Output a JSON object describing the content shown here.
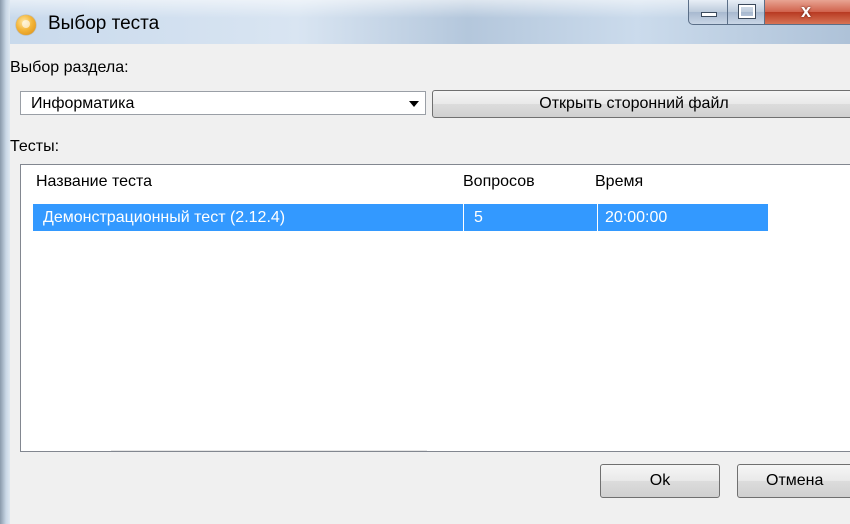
{
  "window": {
    "title": "Выбор теста"
  },
  "section": {
    "label": "Выбор раздела:",
    "selected": "Информатика"
  },
  "toolbar": {
    "open_file_label": "Открыть сторонний файл"
  },
  "tests": {
    "label": "Тесты:",
    "columns": [
      "Название теста",
      "Вопросов",
      "Время"
    ],
    "rows": [
      {
        "name": "Демонстрационный тест (2.12.4)",
        "questions": "5",
        "time": "20:00:00",
        "selected": true
      }
    ]
  },
  "footer": {
    "ok_label": "Ok",
    "cancel_label": "Отмена"
  },
  "colors": {
    "selection": "#3399ff",
    "dialog_bg": "#f0f0f0"
  }
}
